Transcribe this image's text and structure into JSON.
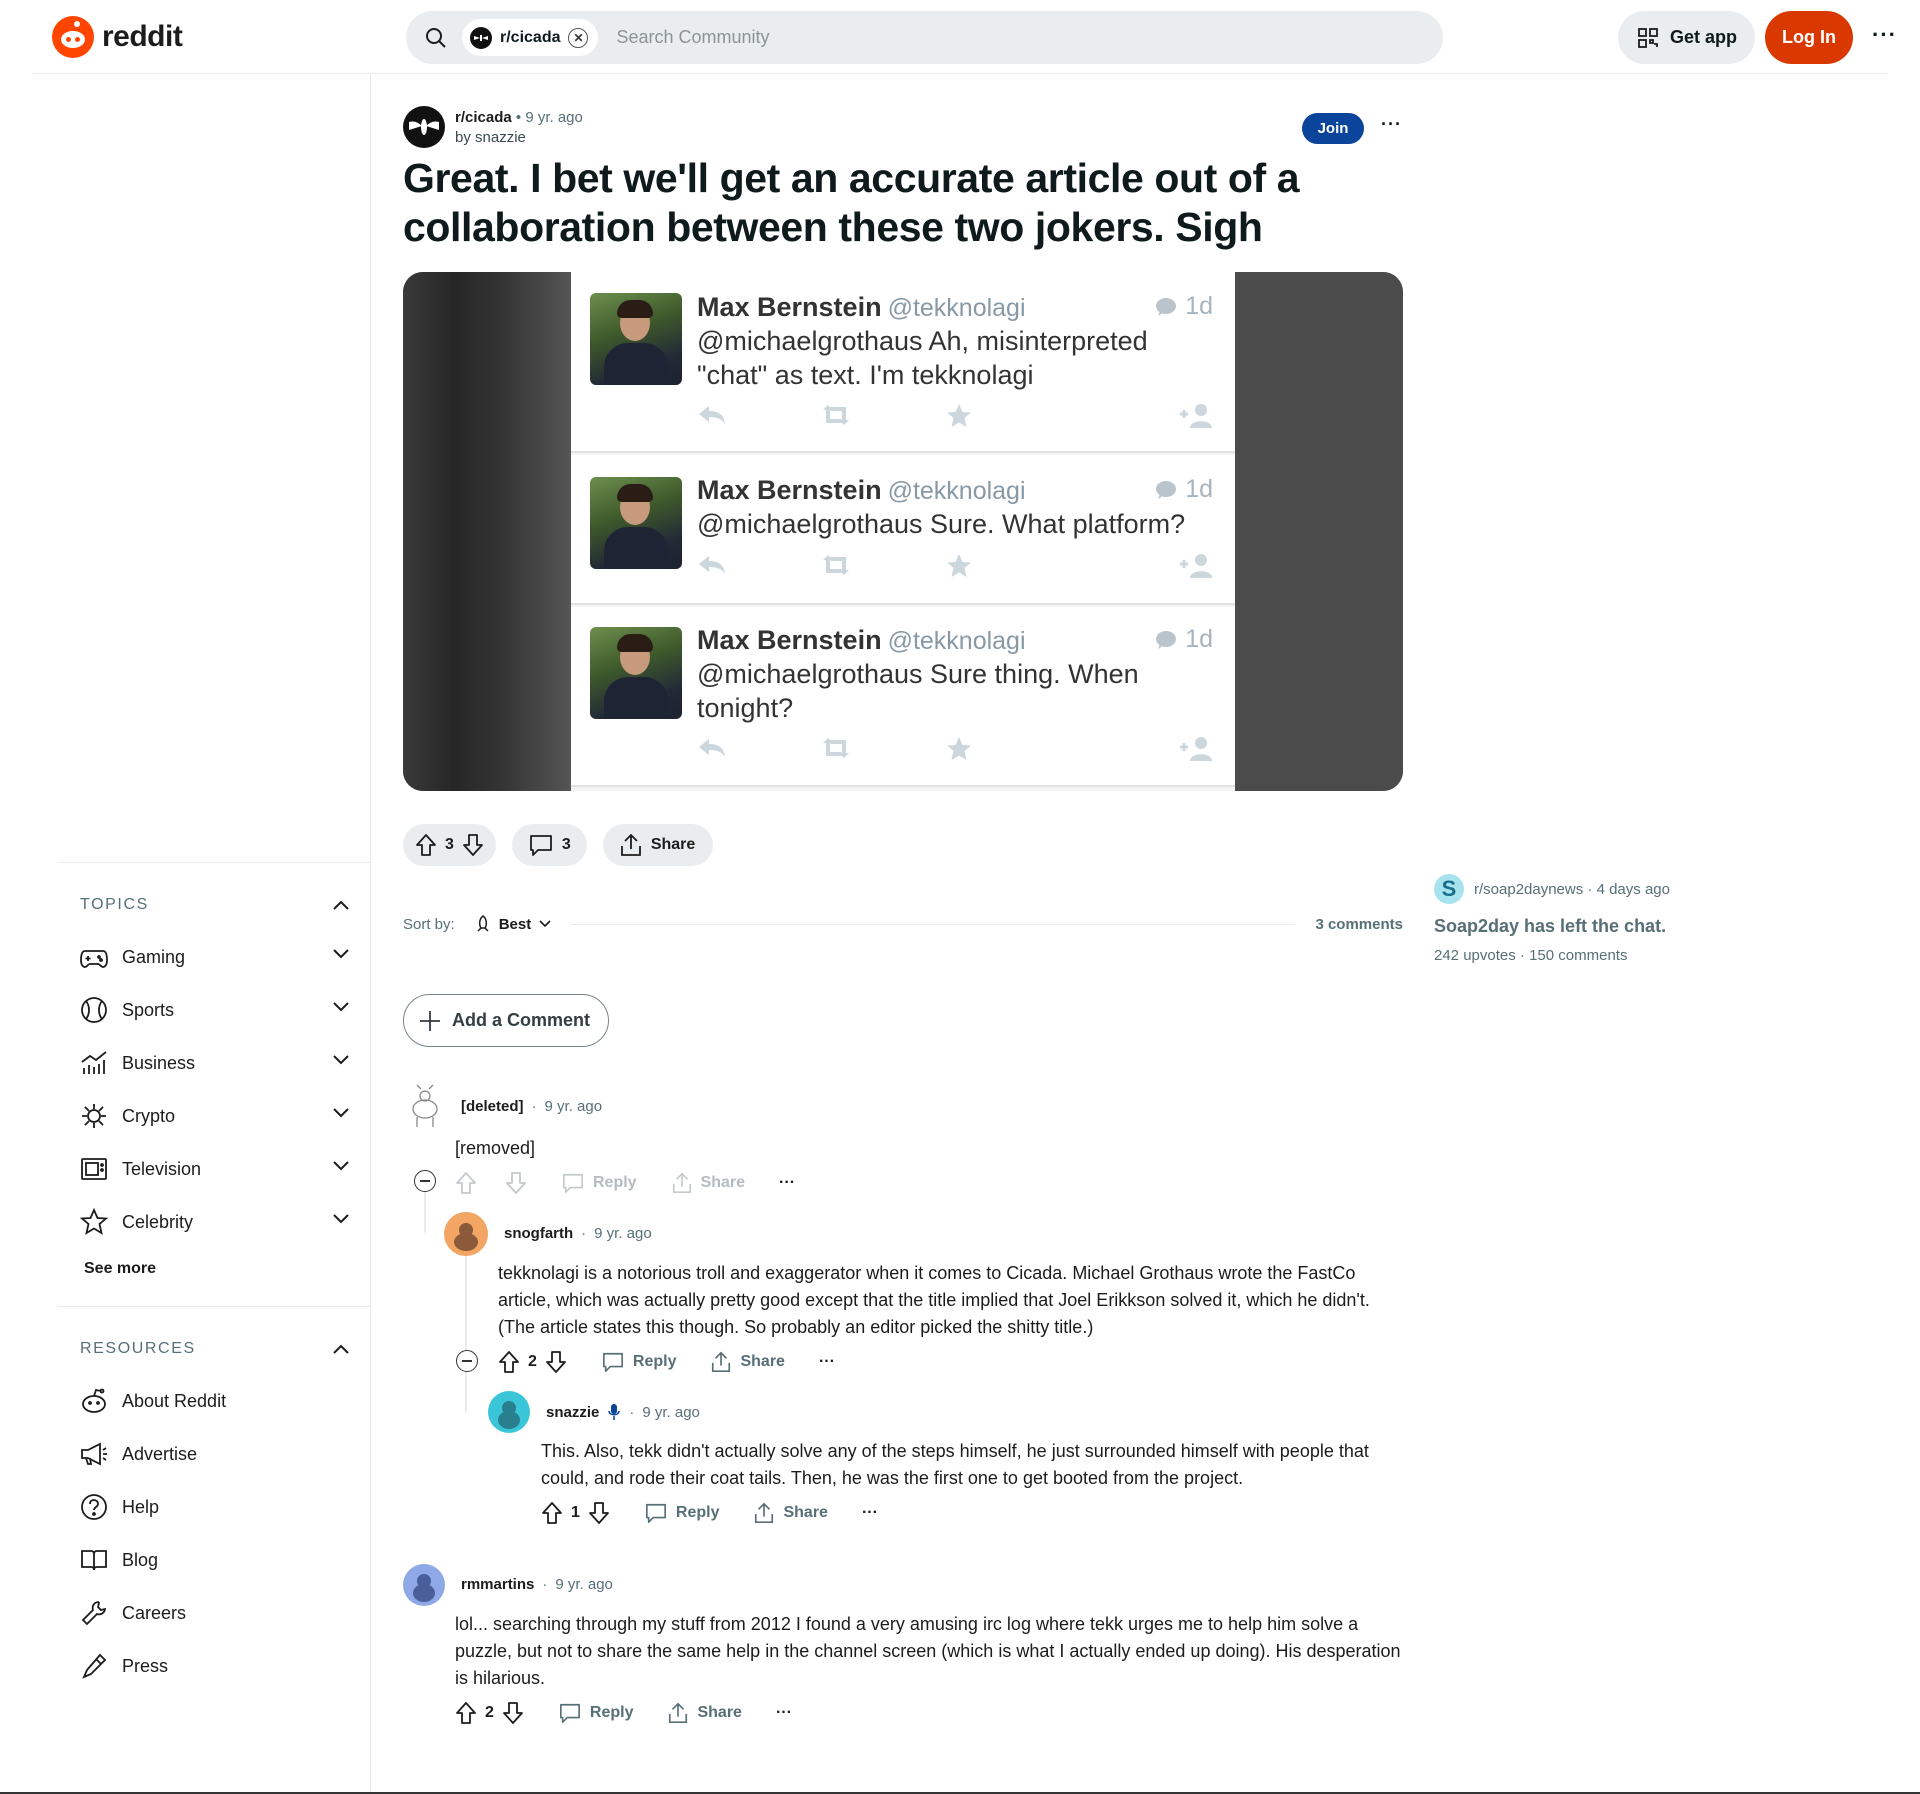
{
  "header": {
    "logo_text": "reddit",
    "search_chip": "r/cicada",
    "search_placeholder": "Search Community",
    "get_app": "Get app",
    "log_in": "Log In"
  },
  "sidebar": {
    "topics_title": "TOPICS",
    "topics": [
      {
        "label": "Gaming",
        "icon": "gamepad-icon"
      },
      {
        "label": "Sports",
        "icon": "ball-icon"
      },
      {
        "label": "Business",
        "icon": "chart-icon"
      },
      {
        "label": "Crypto",
        "icon": "crypto-icon"
      },
      {
        "label": "Television",
        "icon": "tv-icon"
      },
      {
        "label": "Celebrity",
        "icon": "star-icon"
      }
    ],
    "see_more": "See more",
    "resources_title": "RESOURCES",
    "resources": [
      {
        "label": "About Reddit",
        "icon": "reddit-icon"
      },
      {
        "label": "Advertise",
        "icon": "megaphone-icon"
      },
      {
        "label": "Help",
        "icon": "help-icon"
      },
      {
        "label": "Blog",
        "icon": "book-icon"
      },
      {
        "label": "Careers",
        "icon": "wrench-icon"
      },
      {
        "label": "Press",
        "icon": "pen-icon"
      }
    ]
  },
  "post": {
    "subreddit": "r/cicada",
    "age": "9 yr. ago",
    "author": "by snazzie",
    "join": "Join",
    "title": "Great. I bet we'll get an accurate article out of a collaboration between these two jokers. Sigh",
    "upvotes": "3",
    "comments": "3",
    "share": "Share"
  },
  "tweets": [
    {
      "name": "Max Bernstein",
      "handle": "@tekknolagi",
      "time": "1d",
      "text": "@michaelgrothaus Ah, misinterpreted \"chat\" as text. I'm tekknolagi"
    },
    {
      "name": "Max Bernstein",
      "handle": "@tekknolagi",
      "time": "1d",
      "text": "@michaelgrothaus Sure. What platform?"
    },
    {
      "name": "Max Bernstein",
      "handle": "@tekknolagi",
      "time": "1d",
      "text": "@michaelgrothaus Sure thing. When tonight?"
    }
  ],
  "sort": {
    "label": "Sort by:",
    "value": "Best",
    "count": "3 comments"
  },
  "add_comment": "Add a Comment",
  "comments": [
    {
      "author": "[deleted]",
      "age": "9 yr. ago",
      "body": "[removed]",
      "score": "",
      "reply": "Reply",
      "share": "Share"
    },
    {
      "author": "snogfarth",
      "age": "9 yr. ago",
      "body": "tekknolagi is a notorious troll and exaggerator when it comes to Cicada. Michael Grothaus wrote the FastCo article, which was actually pretty good except that the title implied that Joel Erikkson solved it, which he didn't. (The article states this though. So probably an editor picked the shitty title.)",
      "score": "2",
      "reply": "Reply",
      "share": "Share"
    },
    {
      "author": "snazzie",
      "age": "9 yr. ago",
      "body": "This. Also, tekk didn't actually solve any of the steps himself, he just surrounded himself with people that could, and rode their coat tails. Then, he was the first one to get booted from the project.",
      "score": "1",
      "reply": "Reply",
      "share": "Share"
    },
    {
      "author": "rmmartins",
      "age": "9 yr. ago",
      "body": "lol... searching through my stuff from 2012 I found a very amusing irc log where tekk urges me to help him solve a puzzle, but not to share the same help in the channel screen (which is what I actually ended up doing). His desperation is hilarious.",
      "score": "2",
      "reply": "Reply",
      "share": "Share"
    }
  ],
  "rail": {
    "subreddit": "r/soap2daynews",
    "age": "4 days ago",
    "avatar_letter": "S",
    "title": "Soap2day has left the chat.",
    "upvotes": "242 upvotes",
    "comments": "150 comments"
  },
  "colors": {
    "brand": "#ff4500",
    "login": "#d93900",
    "join": "#0a449b",
    "pill": "#eaedef"
  }
}
